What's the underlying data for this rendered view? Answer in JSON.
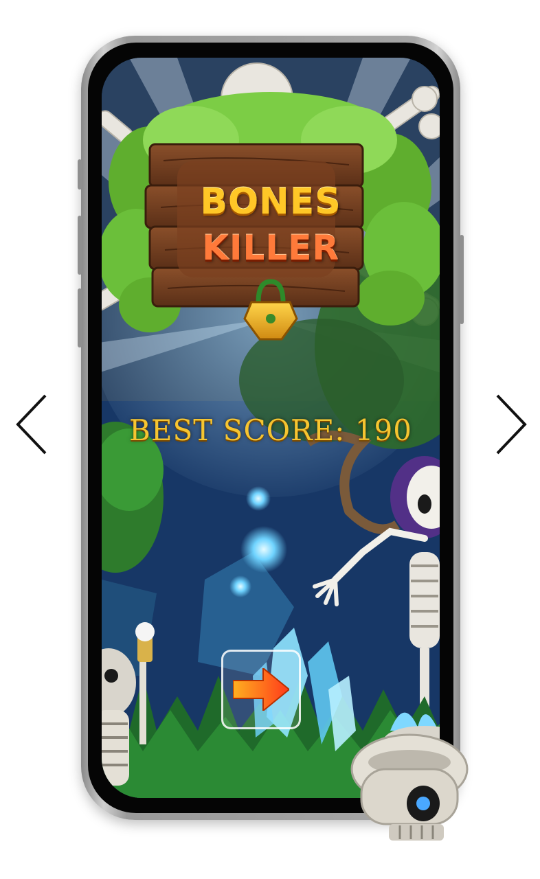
{
  "game": {
    "title_line_1": "BONES",
    "title_line_2": "KILLER",
    "best_score_label": "BEST SCORE: 190"
  },
  "controls": {
    "prev_icon": "chevron-left-icon",
    "next_icon": "chevron-right-icon",
    "play_icon": "arrow-right-icon"
  },
  "colors": {
    "score_gold": "#f6c531",
    "title_yellow": "#ffc727",
    "title_orange": "#ff7a3a",
    "wood_sign": "#6b3b1f",
    "leaves": "#6bbf3a",
    "play_arrow": "#ff5a1f"
  }
}
